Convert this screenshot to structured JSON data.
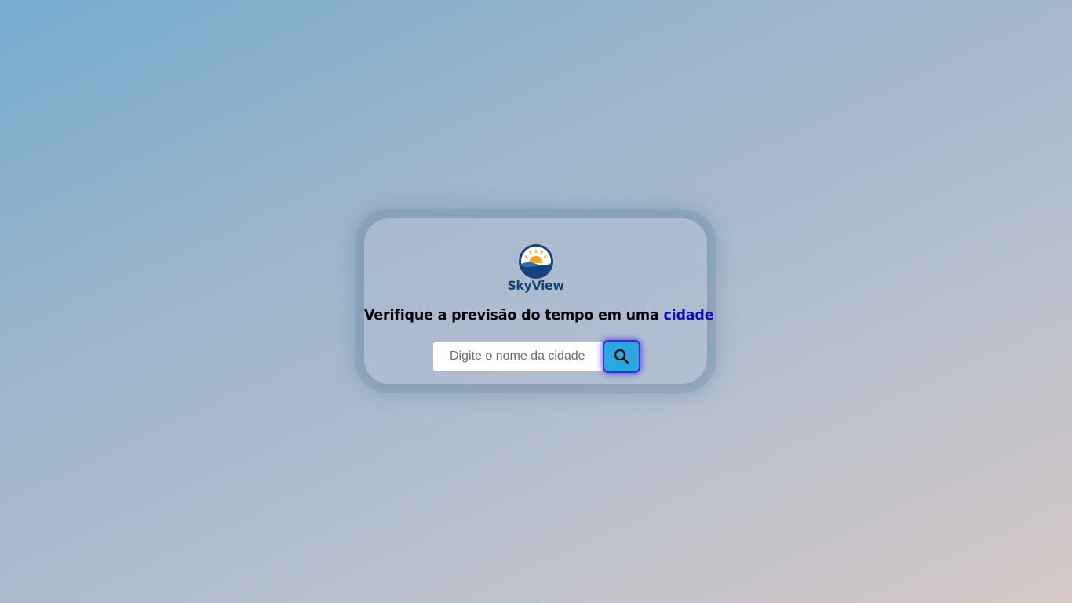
{
  "brand": {
    "name": "SkyView",
    "logo_icon": "sun-over-sea-icon",
    "colors": {
      "primary": "#17437a",
      "sun": "#f4a623"
    }
  },
  "headline": {
    "text": "Verifique a previsão do tempo em uma",
    "accent_word": "cidade",
    "accent_color": "#0a0fbf"
  },
  "search": {
    "placeholder": "Digite o nome da cidade",
    "value": "",
    "button_icon": "search-icon",
    "button_color": "#2ba8e0"
  }
}
